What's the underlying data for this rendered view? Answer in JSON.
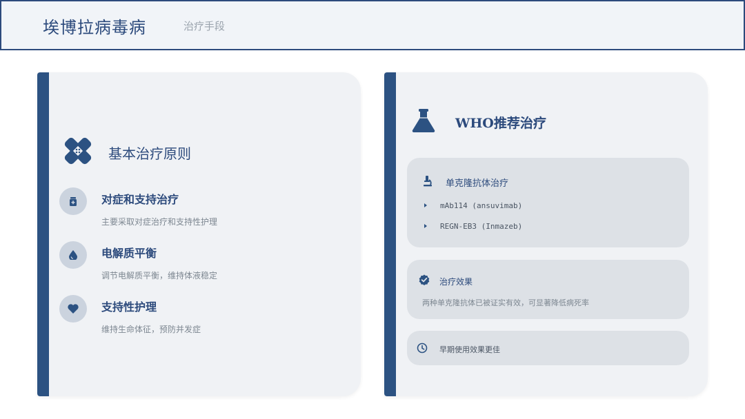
{
  "header": {
    "title": "埃博拉病毒病",
    "subtitle": "治疗手段"
  },
  "left_card": {
    "title": "基本治疗原则",
    "icon": "bandage-icon",
    "items": [
      {
        "icon": "medicine-icon",
        "title": "对症和支持治疗",
        "desc": "主要采取对症治疗和支持性护理"
      },
      {
        "icon": "drop-icon",
        "title": "电解质平衡",
        "desc": "调节电解质平衡，维持体液稳定"
      },
      {
        "icon": "heart-icon",
        "title": "支持性护理",
        "desc": "维持生命体征，预防并发症"
      }
    ]
  },
  "right_card": {
    "title": "WHO推荐治疗",
    "icon": "flask-icon",
    "antibody": {
      "icon": "microscope-icon",
      "title": "单克隆抗体治疗",
      "items": [
        "mAb114 (ansuvimab)",
        "REGN-EB3 (Inmazeb)"
      ]
    },
    "effect": {
      "icon": "check-badge-icon",
      "title": "治疗效果",
      "desc": "两种单克隆抗体已被证实有效，可显著降低病死率"
    },
    "note": {
      "icon": "clock-icon",
      "text": "早期使用效果更佳"
    }
  },
  "colors": {
    "accent": "#2c5282",
    "text": "#2c4a7c",
    "card_bg": "#f0f2f5",
    "panel_bg": "#dde1e6"
  }
}
